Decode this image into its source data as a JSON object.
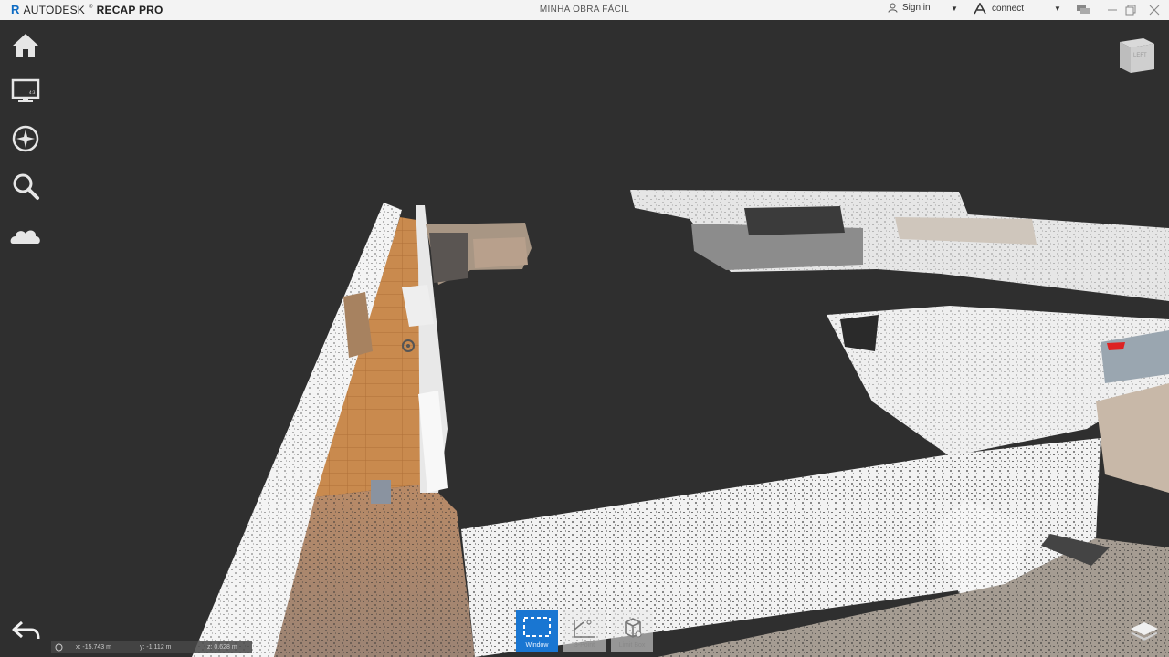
{
  "app": {
    "brand": "AUTODESK",
    "product": "RECAP PRO",
    "title": "MINHA OBRA FÁCIL"
  },
  "titlebar": {
    "signin_label": "Sign in",
    "connect_label": "connect"
  },
  "left_toolbar": [
    "home-icon",
    "display-icon",
    "navigation-wheel-icon",
    "search-icon",
    "cloud-icon"
  ],
  "viewcube": {
    "face_label": "LEFT"
  },
  "coordinates": {
    "x": "x: -15.743 m",
    "y": "y: -1.112 m",
    "z": "z: 0.628 m"
  },
  "selection_tools": [
    {
      "label": "Window",
      "active": true
    },
    {
      "label": "3-Point",
      "active": false
    },
    {
      "label": "Limit Box",
      "active": false
    }
  ],
  "colors": {
    "accent": "#1976d2",
    "titlebar": "#f3f3f3",
    "viewport": "#2f2f2f"
  }
}
